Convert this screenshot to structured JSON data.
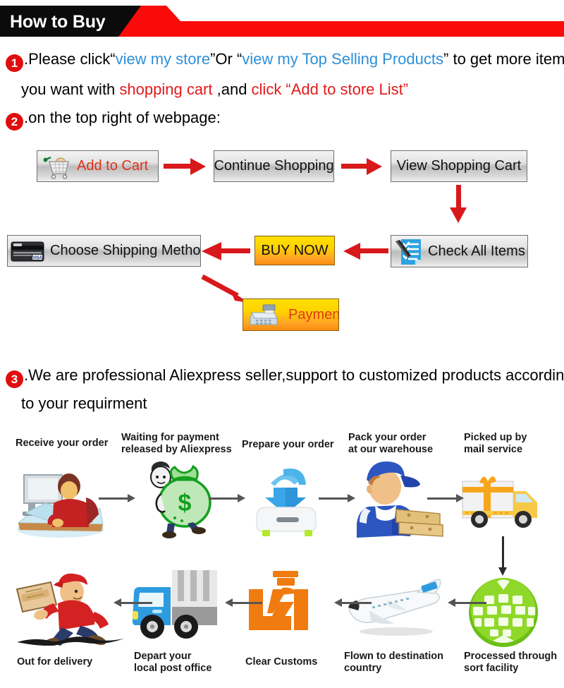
{
  "header": {
    "title": "How to Buy",
    "black_color": "#0b0b0b",
    "red_color": "#fa0a0a"
  },
  "steps": [
    {
      "number": "1",
      "line1_parts": [
        {
          "text": ".Please click“",
          "color": "black"
        },
        {
          "text": "view my store",
          "color": "blue"
        },
        {
          "text": "”Or “",
          "color": "black"
        },
        {
          "text": "view my Top Selling Products",
          "color": "blue"
        },
        {
          "text": "” to get more item",
          "color": "black"
        }
      ],
      "line2_parts": [
        {
          "text": "you want with ",
          "color": "black"
        },
        {
          "text": "shopping cart",
          "color": "red"
        },
        {
          "text": " ,and ",
          "color": "black"
        },
        {
          "text": "click “Add to store List”",
          "color": "red"
        }
      ]
    },
    {
      "number": "2",
      "line1_parts": [
        {
          "text": ".on the top right of webpage:",
          "color": "black"
        }
      ]
    },
    {
      "number": "3",
      "line1_parts": [
        {
          "text": ".We are professional Aliexpress seller,support to customized products accordin",
          "color": "black"
        }
      ],
      "line2_parts": [
        {
          "text": "to your requirment",
          "color": "black"
        }
      ]
    }
  ],
  "flowchart": {
    "buttons": [
      {
        "id": "add-to-cart",
        "label": "Add to Cart",
        "icon": "shopping-cart-icon",
        "style": "gray",
        "label_color": "#e0311b"
      },
      {
        "id": "continue-shopping",
        "label": "Continue Shopping",
        "icon": null,
        "style": "gray",
        "label_color": "#111111"
      },
      {
        "id": "view-shopping-cart",
        "label": "View Shopping Cart",
        "icon": null,
        "style": "gray",
        "label_color": "#111111"
      },
      {
        "id": "check-all-items",
        "label": "Check All Items",
        "icon": "checklist-icon",
        "style": "gray",
        "label_color": "#111111"
      },
      {
        "id": "buy-now",
        "label": "BUY NOW",
        "icon": null,
        "style": "orange",
        "label_color": "#111111"
      },
      {
        "id": "choose-shipping-method",
        "label": "Choose Shipping Method",
        "icon": "credit-card-icon",
        "style": "gray",
        "label_color": "#111111"
      },
      {
        "id": "payment",
        "label": "Payment",
        "icon": "cash-register-icon",
        "style": "orange",
        "label_color": "#e0381b"
      }
    ],
    "arrow_color": "#d8191c"
  },
  "process": {
    "arrow_color": "#555555",
    "row1": [
      {
        "label": "Receive your order",
        "icon": "person-at-computer-icon"
      },
      {
        "label": "Waiting for payment\nreleased by Aliexpress",
        "icon": "money-bag-icon"
      },
      {
        "label": "Prepare your order",
        "icon": "download-box-icon"
      },
      {
        "label": "Pack your order\nat our warehouse",
        "icon": "warehouse-worker-icon"
      },
      {
        "label": "Picked up by\nmail service",
        "icon": "delivery-truck-gift-icon"
      }
    ],
    "row2": [
      {
        "label": "Out for delivery",
        "icon": "running-courier-icon"
      },
      {
        "label": "Depart your\nlocal post office",
        "icon": "blue-post-truck-icon"
      },
      {
        "label": "Clear Customs",
        "icon": "customs-officer-icon"
      },
      {
        "label": "Flown to destination\ncountry",
        "icon": "airplane-icon"
      },
      {
        "label": "Processed through\nsort facility",
        "icon": "green-globe-icon"
      }
    ]
  }
}
